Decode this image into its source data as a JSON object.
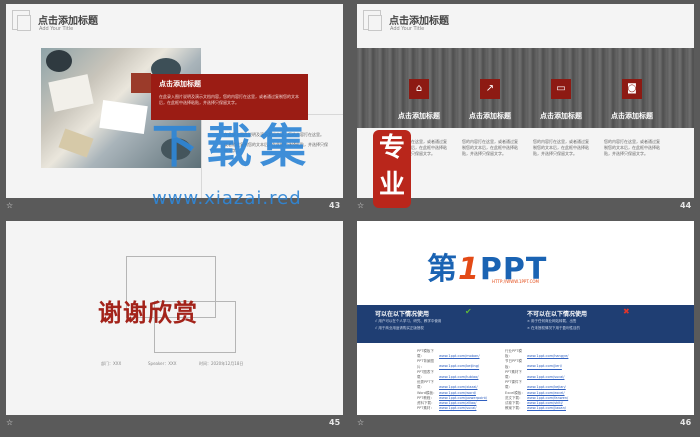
{
  "slide1": {
    "title": "点击添加标题",
    "subtitle": "Add Your Title",
    "red_title": "点击添加标题",
    "red_body": "在此录入图片说明及演示文档内容，您的内容打在这里，或者通过复制您的文本后，在此框中选择粘贴，并选择只保留文字。",
    "bullets": [
      "在此录入图片说明及演示文档内容，您的内容打在这里。",
      "或者通过复制您的文本后，在此框中选择粘贴，并选择只保留文字。"
    ],
    "number": "43"
  },
  "slide2": {
    "title": "点击添加标题",
    "subtitle": "Add Your Title",
    "icons": [
      {
        "name": "home-icon",
        "glyph": "⌂",
        "label": "点击添加标题"
      },
      {
        "name": "chart-icon",
        "glyph": "↗",
        "label": "点击添加标题"
      },
      {
        "name": "box-icon",
        "glyph": "▭",
        "label": "点击添加标题"
      },
      {
        "name": "camera-icon",
        "glyph": "◙",
        "label": "点击添加标题"
      }
    ],
    "col_text": "您的内容打在这里，或者通过复制您的文本后，在此框中选择粘贴，并选择只保留文字。",
    "number": "44"
  },
  "slide3": {
    "thanks": "谢谢欣赏",
    "dept": "部门：XXX",
    "speaker": "Speaker：XXX",
    "time": "时间：2020年12月18日",
    "number": "45"
  },
  "slide4": {
    "logo_main": "第",
    "logo_one": "1",
    "logo_rest": "PPT",
    "logo_url": "HTTP://WWW.1PPT.COM",
    "can_title": "可以在以下情况使用",
    "cannot_title": "不可以在以下情况使用",
    "can_lines": [
      "√ 用户可以在个人学习、研究、教学中使用",
      "√ 用于商业用途请购买正版授权"
    ],
    "cannot_lines": [
      "× 用于任何商业网站转载、出售",
      "× 在未授权情况下用于盈利性目的"
    ],
    "links_left": [
      {
        "label": "PPT模板下载：",
        "url": "www.1ppt.com/moban/"
      },
      {
        "label": "PPT背景图片：",
        "url": "www.1ppt.com/beijing/"
      },
      {
        "label": "PPT图表下载：",
        "url": "www.1ppt.com/tubiao/"
      },
      {
        "label": "优秀PPT下载：",
        "url": "www.1ppt.com/xiazai/"
      },
      {
        "label": "Word模板：",
        "url": "www.1ppt.com/word/"
      },
      {
        "label": "PPT教程：",
        "url": "www.1ppt.com/powerpoint/"
      },
      {
        "label": "资料下载：",
        "url": "www.1ppt.com/ziliao/"
      },
      {
        "label": "PPT素材：",
        "url": "www.1ppt.com/sucai/"
      }
    ],
    "links_right": [
      {
        "label": "行业PPT模板：",
        "url": "www.1ppt.com/hangye/"
      },
      {
        "label": "节日PPT模板：",
        "url": "www.1ppt.com/jieri/"
      },
      {
        "label": "PPT素材下载：",
        "url": "www.1ppt.com/sucai/"
      },
      {
        "label": "PPT课件下载：",
        "url": "www.1ppt.com/kejian/"
      },
      {
        "label": "Excel模板：",
        "url": "www.1ppt.com/excel/"
      },
      {
        "label": "范文下载：",
        "url": "www.1ppt.com/fanwen/"
      },
      {
        "label": "试卷下载：",
        "url": "www.1ppt.com/shiti/"
      },
      {
        "label": "教案下载：",
        "url": "www.1ppt.com/jiaoan/"
      }
    ],
    "number": "46"
  },
  "watermark": {
    "title": "下载集",
    "url": "www.xiazai.red",
    "seal": "专业"
  },
  "star": "☆"
}
